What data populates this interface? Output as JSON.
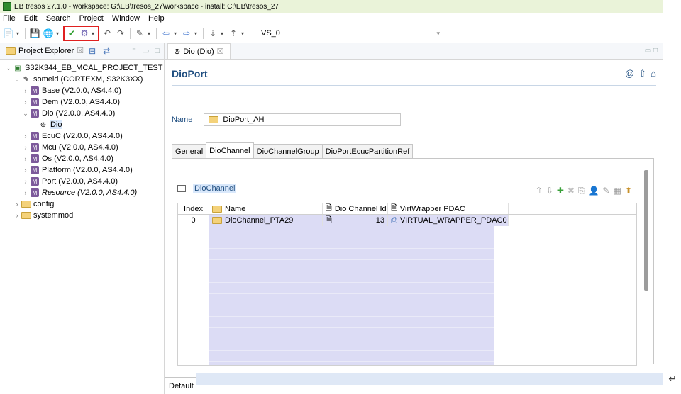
{
  "window": {
    "title": "EB tresos 27.1.0 - workspace: G:\\EB\\tresos_27\\workspace - install: C:\\EB\\tresos_27"
  },
  "menubar": [
    "File",
    "Edit",
    "Search",
    "Project",
    "Window",
    "Help"
  ],
  "toolbar": {
    "variant_select": "VS_0"
  },
  "project_explorer": {
    "title": "Project Explorer",
    "close_glyph": "☒",
    "tree": [
      {
        "label": "S32K344_EB_MCAL_PROJECT_TEST",
        "level": 0
      },
      {
        "label": "someld (CORTEXM, S32K3XX)",
        "level": 1
      },
      {
        "label": "Base (V2.0.0, AS4.4.0)",
        "level": 2
      },
      {
        "label": "Dem (V2.0.0, AS4.4.0)",
        "level": 2
      },
      {
        "label": "Dio (V2.0.0, AS4.4.0)",
        "level": 2
      },
      {
        "label": "Dio",
        "level": 3
      },
      {
        "label": "EcuC (V2.0.0, AS4.4.0)",
        "level": 2
      },
      {
        "label": "Mcu (V2.0.0, AS4.4.0)",
        "level": 2
      },
      {
        "label": "Os (V2.0.0, AS4.4.0)",
        "level": 2
      },
      {
        "label": "Platform (V2.0.0, AS4.4.0)",
        "level": 2
      },
      {
        "label": "Port (V2.0.0, AS4.4.0)",
        "level": 2
      },
      {
        "label": "Resource (V2.0.0, AS4.4.0)",
        "level": 2,
        "italic": true
      },
      {
        "label": "config",
        "level": 1
      },
      {
        "label": "systemmod",
        "level": 1
      }
    ]
  },
  "editor": {
    "tab_label": "Dio (Dio)",
    "close_glyph": "☒",
    "form_title": "DioPort",
    "name_label": "Name",
    "name_value": "DioPort_AH",
    "sub_tabs": [
      "General",
      "DioChannel",
      "DioChannelGroup",
      "DioPortEcucPartitionRef"
    ],
    "table_title": "DioChannel",
    "columns": [
      "Index",
      "Name",
      "Dio Channel Id",
      "VirtWrapper PDAC"
    ],
    "rows": [
      {
        "index": "0",
        "name": "DioChannel_PTA29",
        "channel_id": "13",
        "vw": "VIRTUAL_WRAPPER_PDAC0"
      }
    ]
  },
  "status": {
    "default_label": "Default"
  },
  "colors": {
    "titlebar_bg": "#eaf3d9",
    "highlight_red": "#e02020",
    "link_blue": "#1f4e80",
    "row_lavender": "#dcdcf5"
  }
}
